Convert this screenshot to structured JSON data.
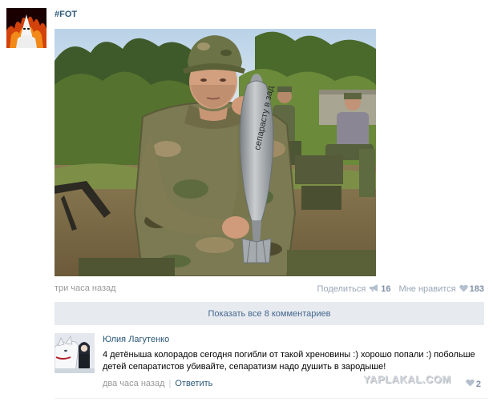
{
  "post": {
    "author": "#FOT",
    "photo_inscription": "сепарасту в зад",
    "time": "три часа назад",
    "share_label": "Поделиться",
    "share_count": "16",
    "like_label": "Мне нравится",
    "like_count": "183"
  },
  "show_comments_label": "Показать все 8 комментариев",
  "comment": {
    "author": "Юлия Лагутенко",
    "text": "4 детёныша колорадов сегодня погибли от такой хреновины :) хорошо попали :) побольше детей сепаратистов убивайте, сепаратизм надо душить в зародыше!",
    "time": "два часа назад",
    "separator": "|",
    "reply_label": "Ответить",
    "like_count": "2"
  },
  "watermark": "YAPLAKAL.COM",
  "icons": {
    "share": "megaphone-icon",
    "like": "heart-icon",
    "comment_like": "heart-icon"
  },
  "colors": {
    "link": "#2b587a",
    "muted": "#999999",
    "count": "#7f8fa7",
    "bar": "#e7ebf0",
    "bar_text": "#45668e"
  }
}
